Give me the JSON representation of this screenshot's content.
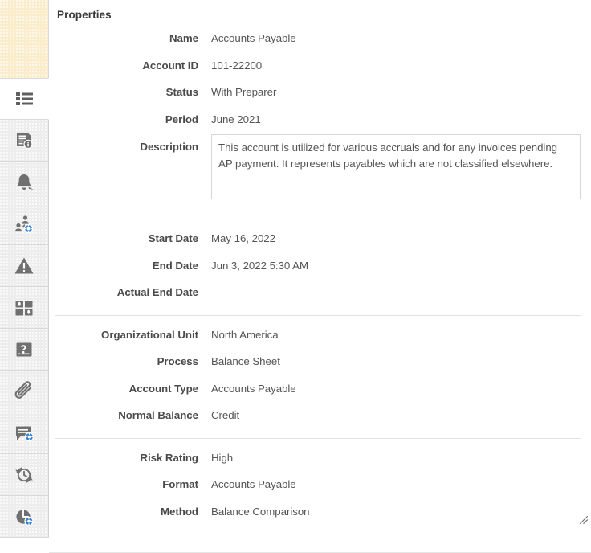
{
  "panel": {
    "title": "Properties"
  },
  "sidebar": {
    "tabs": [
      {
        "name": "properties",
        "icon": "list-icon",
        "selected": true
      },
      {
        "name": "instructions",
        "icon": "document-info-icon",
        "selected": false
      },
      {
        "name": "alerts",
        "icon": "bell-icon",
        "selected": false
      },
      {
        "name": "workflow",
        "icon": "users-workflow-icon",
        "selected": false
      },
      {
        "name": "warnings",
        "icon": "warning-triangle-icon",
        "selected": false
      },
      {
        "name": "viewers",
        "icon": "grid-panels-icon",
        "selected": false
      },
      {
        "name": "questions",
        "icon": "question-card-icon",
        "selected": false
      },
      {
        "name": "attachments",
        "icon": "paperclip-icon",
        "selected": false
      },
      {
        "name": "comments",
        "icon": "comment-add-icon",
        "selected": false
      },
      {
        "name": "history",
        "icon": "clock-refresh-icon",
        "selected": false
      },
      {
        "name": "schedule",
        "icon": "pie-clock-icon",
        "selected": false
      }
    ]
  },
  "sections": [
    {
      "fields": [
        {
          "label": "Name",
          "value": "Accounts Payable"
        },
        {
          "label": "Account ID",
          "value": "101-22200"
        },
        {
          "label": "Status",
          "value": "With Preparer"
        },
        {
          "label": "Period",
          "value": "June 2021"
        }
      ],
      "description": {
        "label": "Description",
        "value": "This account is utilized for various accruals and for any invoices pending AP payment. It represents payables which are not classified elsewhere."
      }
    },
    {
      "fields": [
        {
          "label": "Start Date",
          "value": "May 16, 2022"
        },
        {
          "label": "End Date",
          "value": "Jun 3, 2022 5:30 AM"
        },
        {
          "label": "Actual End Date",
          "value": ""
        }
      ]
    },
    {
      "fields": [
        {
          "label": "Organizational Unit",
          "value": "North America"
        },
        {
          "label": "Process",
          "value": "Balance Sheet"
        },
        {
          "label": "Account Type",
          "value": "Accounts Payable"
        },
        {
          "label": "Normal Balance",
          "value": "Credit"
        }
      ]
    },
    {
      "fields": [
        {
          "label": "Risk Rating",
          "value": "High"
        },
        {
          "label": "Format",
          "value": "Accounts Payable"
        },
        {
          "label": "Method",
          "value": "Balance Comparison"
        }
      ]
    }
  ],
  "colors": {
    "banner": "#fbeccb",
    "rail_tab": "#ededed",
    "rail_tab_selected": "#ffffff",
    "icon": "#707070",
    "badge_blue": "#2f7fd0",
    "label_text": "#4a4a4a",
    "value_text": "#555555",
    "divider": "#e2e2e2",
    "field_border": "#d6d6d6"
  }
}
